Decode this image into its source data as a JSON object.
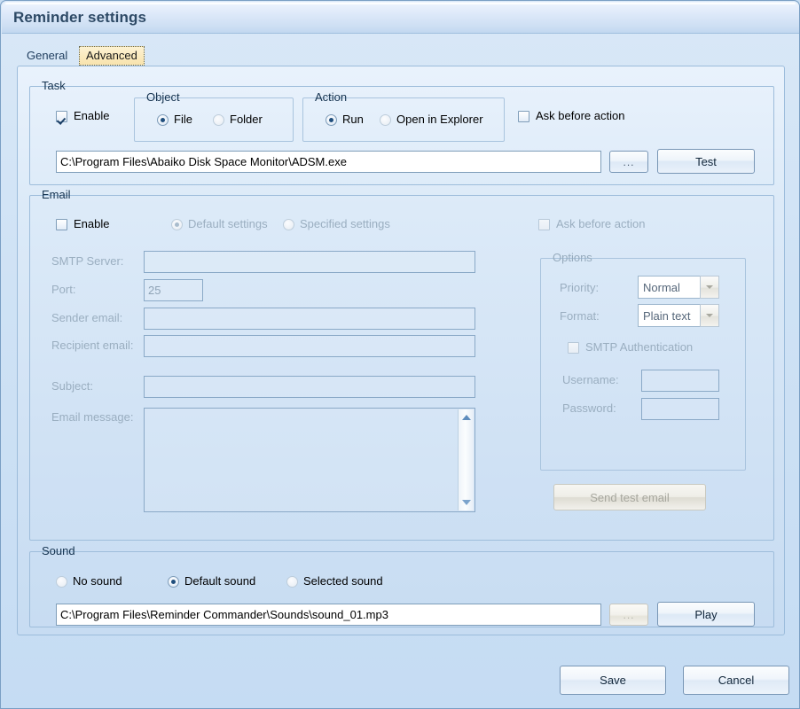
{
  "window": {
    "title": "Reminder settings"
  },
  "tabs": [
    {
      "label": "General",
      "selected": false
    },
    {
      "label": "Advanced",
      "selected": true
    }
  ],
  "task": {
    "legend": "Task",
    "enable_label": "Enable",
    "enable_checked": true,
    "object": {
      "legend": "Object",
      "options": [
        {
          "label": "File",
          "selected": true
        },
        {
          "label": "Folder",
          "selected": false
        }
      ]
    },
    "action": {
      "legend": "Action",
      "options": [
        {
          "label": "Run",
          "selected": true
        },
        {
          "label": "Open in Explorer",
          "selected": false
        }
      ]
    },
    "ask_before_action_label": "Ask before action",
    "ask_before_action_checked": false,
    "path_value": "C:\\Program Files\\Abaiko Disk Space Monitor\\ADSM.exe",
    "browse_label": "...",
    "test_label": "Test"
  },
  "email": {
    "legend": "Email",
    "enable_label": "Enable",
    "enable_checked": false,
    "settings_mode": [
      {
        "label": "Default settings",
        "selected": true
      },
      {
        "label": "Specified settings",
        "selected": false
      }
    ],
    "ask_before_action_label": "Ask before action",
    "ask_before_action_checked": false,
    "fields": [
      {
        "label": "SMTP Server:",
        "value": ""
      },
      {
        "label": "Port:",
        "value": "25"
      },
      {
        "label": "Sender email:",
        "value": ""
      },
      {
        "label": "Recipient email:",
        "value": ""
      },
      {
        "label": "Subject:",
        "value": ""
      },
      {
        "label": "Email message:",
        "value": ""
      }
    ],
    "options": {
      "legend": "Options",
      "priority_label": "Priority:",
      "priority_value": "Normal",
      "format_label": "Format:",
      "format_value": "Plain text",
      "smtp_auth_label": "SMTP Authentication",
      "smtp_auth_checked": false,
      "username_label": "Username:",
      "username_value": "",
      "password_label": "Password:",
      "password_value": ""
    },
    "send_test_label": "Send test email"
  },
  "sound": {
    "legend": "Sound",
    "options": [
      {
        "label": "No sound",
        "selected": false
      },
      {
        "label": "Default sound",
        "selected": true
      },
      {
        "label": "Selected sound",
        "selected": false
      }
    ],
    "path_value": "C:\\Program Files\\Reminder Commander\\Sounds\\sound_01.mp3",
    "browse_label": "...",
    "play_label": "Play"
  },
  "footer": {
    "save_label": "Save",
    "cancel_label": "Cancel"
  },
  "colors": {
    "accent": "#2e4a66",
    "panel": "#cfe1f4",
    "tab_selected_bg": "#f8e3ad",
    "border": "#9ebddb"
  }
}
